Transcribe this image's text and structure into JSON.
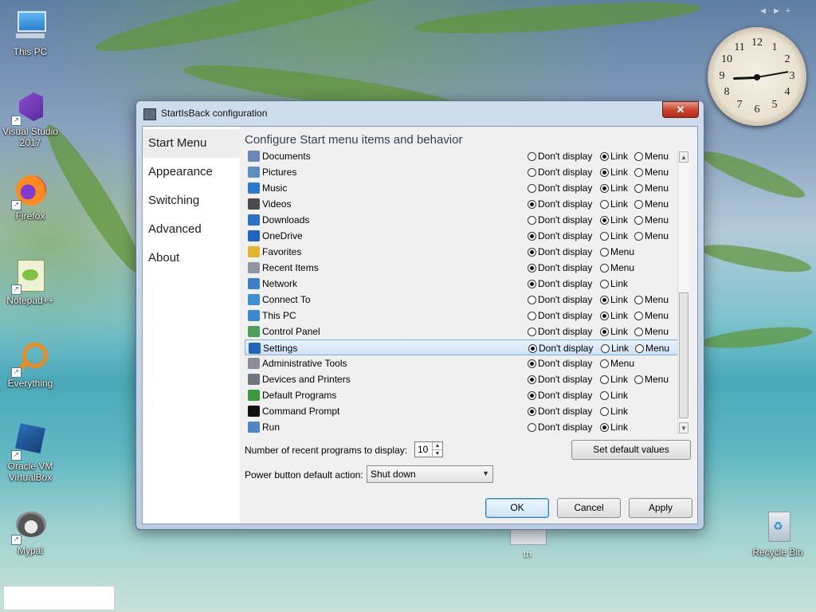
{
  "desktop": {
    "icons": [
      {
        "label": "This PC",
        "icon": "computer-icon"
      },
      {
        "label": "Visual Studio 2017",
        "icon": "visual-studio-icon"
      },
      {
        "label": "Firefox",
        "icon": "firefox-icon"
      },
      {
        "label": "Notepad++",
        "icon": "notepadpp-icon"
      },
      {
        "label": "Everything",
        "icon": "magnifier-icon"
      },
      {
        "label": "Oracle VM VirtualBox",
        "icon": "virtualbox-icon"
      },
      {
        "label": "Mypal",
        "icon": "mypal-icon"
      }
    ],
    "recycle_bin": {
      "label": "Recycle Bin",
      "icon": "recycle-bin-icon"
    },
    "th_item": {
      "label": "th"
    },
    "gadget_nav": {
      "prev": "◄",
      "next": "►",
      "add": "+"
    }
  },
  "clock": {
    "numerals": [
      "12",
      "1",
      "2",
      "3",
      "4",
      "5",
      "6",
      "7",
      "8",
      "9",
      "10",
      "11"
    ]
  },
  "dialog": {
    "title": "StartIsBack configuration",
    "close_glyph": "✕",
    "nav": [
      {
        "label": "Start Menu",
        "active": true
      },
      {
        "label": "Appearance",
        "active": false
      },
      {
        "label": "Switching",
        "active": false
      },
      {
        "label": "Advanced",
        "active": false
      },
      {
        "label": "About",
        "active": false
      }
    ],
    "heading": "Configure Start menu items and behavior",
    "option_labels": {
      "dont": "Don't display",
      "link": "Link",
      "menu": "Menu"
    },
    "items": [
      {
        "name": "Documents",
        "icon": "documents-icon",
        "color": "#6b86b8",
        "opts": [
          "dont",
          "link",
          "menu"
        ],
        "selected": "link"
      },
      {
        "name": "Pictures",
        "icon": "pictures-icon",
        "color": "#5a8fbf",
        "opts": [
          "dont",
          "link",
          "menu"
        ],
        "selected": "link"
      },
      {
        "name": "Music",
        "icon": "music-icon",
        "color": "#2a7ad1",
        "opts": [
          "dont",
          "link",
          "menu"
        ],
        "selected": "link"
      },
      {
        "name": "Videos",
        "icon": "videos-icon",
        "color": "#4a4a4a",
        "opts": [
          "dont",
          "link",
          "menu"
        ],
        "selected": "dont"
      },
      {
        "name": "Downloads",
        "icon": "downloads-icon",
        "color": "#2d71c9",
        "opts": [
          "dont",
          "link",
          "menu"
        ],
        "selected": "link"
      },
      {
        "name": "OneDrive",
        "icon": "onedrive-icon",
        "color": "#1f63c4",
        "opts": [
          "dont",
          "link",
          "menu"
        ],
        "selected": "dont"
      },
      {
        "name": "Favorites",
        "icon": "favorites-icon",
        "color": "#e3b52c",
        "opts": [
          "dont",
          "menu"
        ],
        "selected": "dont"
      },
      {
        "name": "Recent Items",
        "icon": "recent-items-icon",
        "color": "#8f969e",
        "opts": [
          "dont",
          "menu"
        ],
        "selected": "dont"
      },
      {
        "name": "Network",
        "icon": "network-icon",
        "color": "#3c7fc8",
        "opts": [
          "dont",
          "link"
        ],
        "selected": "dont"
      },
      {
        "name": "Connect To",
        "icon": "connect-to-icon",
        "color": "#3b8fd3",
        "opts": [
          "dont",
          "link",
          "menu"
        ],
        "selected": "link"
      },
      {
        "name": "This PC",
        "icon": "this-pc-icon",
        "color": "#3a86cf",
        "opts": [
          "dont",
          "link",
          "menu"
        ],
        "selected": "link"
      },
      {
        "name": "Control Panel",
        "icon": "control-panel-icon",
        "color": "#4c9e5a",
        "opts": [
          "dont",
          "link",
          "menu"
        ],
        "selected": "link"
      },
      {
        "name": "Settings",
        "icon": "settings-icon",
        "color": "#2166b8",
        "opts": [
          "dont",
          "link",
          "menu"
        ],
        "selected": "dont"
      },
      {
        "name": "Administrative Tools",
        "icon": "administrative-tools-icon",
        "color": "#8a8f96",
        "opts": [
          "dont",
          "menu"
        ],
        "selected": "dont"
      },
      {
        "name": "Devices and Printers",
        "icon": "devices-printers-icon",
        "color": "#6f7680",
        "opts": [
          "dont",
          "link",
          "menu"
        ],
        "selected": "dont"
      },
      {
        "name": "Default Programs",
        "icon": "default-programs-icon",
        "color": "#3b9a3b",
        "opts": [
          "dont",
          "link"
        ],
        "selected": "dont"
      },
      {
        "name": "Command Prompt",
        "icon": "command-prompt-icon",
        "color": "#111111",
        "opts": [
          "dont",
          "link"
        ],
        "selected": "dont"
      },
      {
        "name": "Run",
        "icon": "run-icon",
        "color": "#4f86c6",
        "opts": [
          "dont",
          "link"
        ],
        "selected": "link"
      }
    ],
    "selected_row": "Settings",
    "recent_label": "Number of recent programs to display:",
    "recent_value": "10",
    "power_label": "Power button default action:",
    "power_value": "Shut down",
    "set_default_label": "Set default values",
    "ok_label": "OK",
    "cancel_label": "Cancel",
    "apply_label": "Apply"
  }
}
